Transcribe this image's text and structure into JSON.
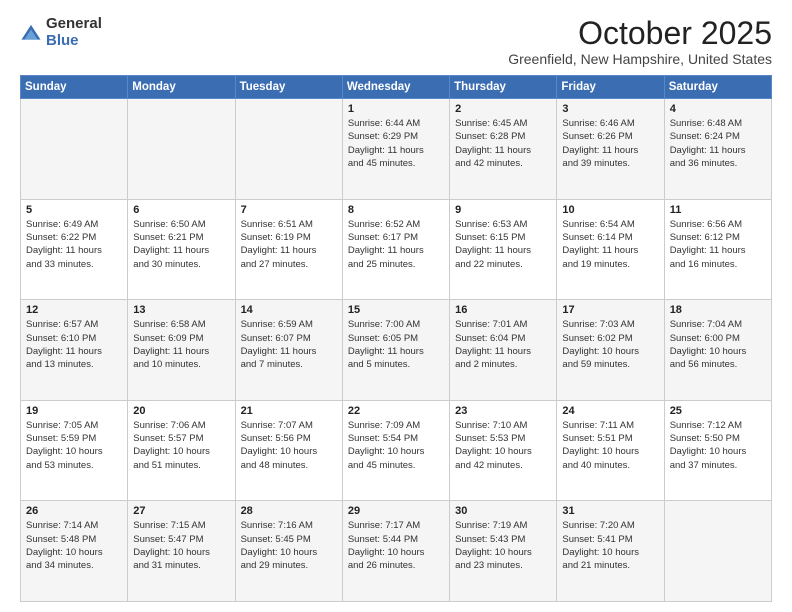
{
  "logo": {
    "general": "General",
    "blue": "Blue"
  },
  "header": {
    "month": "October 2025",
    "location": "Greenfield, New Hampshire, United States"
  },
  "weekdays": [
    "Sunday",
    "Monday",
    "Tuesday",
    "Wednesday",
    "Thursday",
    "Friday",
    "Saturday"
  ],
  "weeks": [
    [
      {
        "day": "",
        "detail": ""
      },
      {
        "day": "",
        "detail": ""
      },
      {
        "day": "",
        "detail": ""
      },
      {
        "day": "1",
        "detail": "Sunrise: 6:44 AM\nSunset: 6:29 PM\nDaylight: 11 hours\nand 45 minutes."
      },
      {
        "day": "2",
        "detail": "Sunrise: 6:45 AM\nSunset: 6:28 PM\nDaylight: 11 hours\nand 42 minutes."
      },
      {
        "day": "3",
        "detail": "Sunrise: 6:46 AM\nSunset: 6:26 PM\nDaylight: 11 hours\nand 39 minutes."
      },
      {
        "day": "4",
        "detail": "Sunrise: 6:48 AM\nSunset: 6:24 PM\nDaylight: 11 hours\nand 36 minutes."
      }
    ],
    [
      {
        "day": "5",
        "detail": "Sunrise: 6:49 AM\nSunset: 6:22 PM\nDaylight: 11 hours\nand 33 minutes."
      },
      {
        "day": "6",
        "detail": "Sunrise: 6:50 AM\nSunset: 6:21 PM\nDaylight: 11 hours\nand 30 minutes."
      },
      {
        "day": "7",
        "detail": "Sunrise: 6:51 AM\nSunset: 6:19 PM\nDaylight: 11 hours\nand 27 minutes."
      },
      {
        "day": "8",
        "detail": "Sunrise: 6:52 AM\nSunset: 6:17 PM\nDaylight: 11 hours\nand 25 minutes."
      },
      {
        "day": "9",
        "detail": "Sunrise: 6:53 AM\nSunset: 6:15 PM\nDaylight: 11 hours\nand 22 minutes."
      },
      {
        "day": "10",
        "detail": "Sunrise: 6:54 AM\nSunset: 6:14 PM\nDaylight: 11 hours\nand 19 minutes."
      },
      {
        "day": "11",
        "detail": "Sunrise: 6:56 AM\nSunset: 6:12 PM\nDaylight: 11 hours\nand 16 minutes."
      }
    ],
    [
      {
        "day": "12",
        "detail": "Sunrise: 6:57 AM\nSunset: 6:10 PM\nDaylight: 11 hours\nand 13 minutes."
      },
      {
        "day": "13",
        "detail": "Sunrise: 6:58 AM\nSunset: 6:09 PM\nDaylight: 11 hours\nand 10 minutes."
      },
      {
        "day": "14",
        "detail": "Sunrise: 6:59 AM\nSunset: 6:07 PM\nDaylight: 11 hours\nand 7 minutes."
      },
      {
        "day": "15",
        "detail": "Sunrise: 7:00 AM\nSunset: 6:05 PM\nDaylight: 11 hours\nand 5 minutes."
      },
      {
        "day": "16",
        "detail": "Sunrise: 7:01 AM\nSunset: 6:04 PM\nDaylight: 11 hours\nand 2 minutes."
      },
      {
        "day": "17",
        "detail": "Sunrise: 7:03 AM\nSunset: 6:02 PM\nDaylight: 10 hours\nand 59 minutes."
      },
      {
        "day": "18",
        "detail": "Sunrise: 7:04 AM\nSunset: 6:00 PM\nDaylight: 10 hours\nand 56 minutes."
      }
    ],
    [
      {
        "day": "19",
        "detail": "Sunrise: 7:05 AM\nSunset: 5:59 PM\nDaylight: 10 hours\nand 53 minutes."
      },
      {
        "day": "20",
        "detail": "Sunrise: 7:06 AM\nSunset: 5:57 PM\nDaylight: 10 hours\nand 51 minutes."
      },
      {
        "day": "21",
        "detail": "Sunrise: 7:07 AM\nSunset: 5:56 PM\nDaylight: 10 hours\nand 48 minutes."
      },
      {
        "day": "22",
        "detail": "Sunrise: 7:09 AM\nSunset: 5:54 PM\nDaylight: 10 hours\nand 45 minutes."
      },
      {
        "day": "23",
        "detail": "Sunrise: 7:10 AM\nSunset: 5:53 PM\nDaylight: 10 hours\nand 42 minutes."
      },
      {
        "day": "24",
        "detail": "Sunrise: 7:11 AM\nSunset: 5:51 PM\nDaylight: 10 hours\nand 40 minutes."
      },
      {
        "day": "25",
        "detail": "Sunrise: 7:12 AM\nSunset: 5:50 PM\nDaylight: 10 hours\nand 37 minutes."
      }
    ],
    [
      {
        "day": "26",
        "detail": "Sunrise: 7:14 AM\nSunset: 5:48 PM\nDaylight: 10 hours\nand 34 minutes."
      },
      {
        "day": "27",
        "detail": "Sunrise: 7:15 AM\nSunset: 5:47 PM\nDaylight: 10 hours\nand 31 minutes."
      },
      {
        "day": "28",
        "detail": "Sunrise: 7:16 AM\nSunset: 5:45 PM\nDaylight: 10 hours\nand 29 minutes."
      },
      {
        "day": "29",
        "detail": "Sunrise: 7:17 AM\nSunset: 5:44 PM\nDaylight: 10 hours\nand 26 minutes."
      },
      {
        "day": "30",
        "detail": "Sunrise: 7:19 AM\nSunset: 5:43 PM\nDaylight: 10 hours\nand 23 minutes."
      },
      {
        "day": "31",
        "detail": "Sunrise: 7:20 AM\nSunset: 5:41 PM\nDaylight: 10 hours\nand 21 minutes."
      },
      {
        "day": "",
        "detail": ""
      }
    ]
  ]
}
